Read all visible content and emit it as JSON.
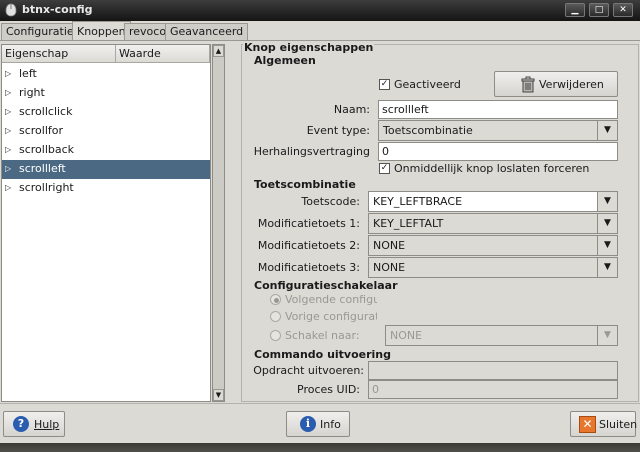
{
  "window": {
    "title": "btnx-config"
  },
  "tabs": [
    {
      "label": "Configuraties"
    },
    {
      "label": "Knoppen"
    },
    {
      "label": "revoco"
    },
    {
      "label": "Geavanceerd"
    }
  ],
  "tree": {
    "columns": [
      "Eigenschap",
      "Waarde"
    ],
    "items": [
      {
        "label": "left"
      },
      {
        "label": "right"
      },
      {
        "label": "scrollclick"
      },
      {
        "label": "scrollfor"
      },
      {
        "label": "scrollback"
      },
      {
        "label": "scrollleft",
        "selected": true
      },
      {
        "label": "scrollright"
      }
    ]
  },
  "props": {
    "frame_title": "Knop eigenschappen",
    "algemeen": {
      "title": "Algemeen",
      "enabled_label": "Geactiveerd",
      "enabled_checked": true,
      "delete_button": "Verwijderen",
      "name_label": "Naam:",
      "name_value": "scrollleft",
      "event_type_label": "Event type:",
      "event_type_value": "Toetscombinatie",
      "delay_label": "Herhalingsvertraging",
      "delay_value": "0",
      "force_release_label": "Onmiddellijk knop loslaten forceren",
      "force_release_checked": true
    },
    "keycombo": {
      "title": "Toetscombinatie",
      "keycode_label": "Toetscode:",
      "keycode_value": "KEY_LEFTBRACE",
      "mod1_label": "Modificatietoets 1:",
      "mod1_value": "KEY_LEFTALT",
      "mod2_label": "Modificatietoets 2:",
      "mod2_value": "NONE",
      "mod3_label": "Modificatietoets 3:",
      "mod3_value": "NONE"
    },
    "configswitch": {
      "title": "Configuratieschakelaar",
      "next_label": "Volgende configura",
      "prev_label": "Vorige configuratie",
      "switch_label": "Schakel naar:",
      "switch_value": "NONE"
    },
    "command": {
      "title": "Commando uitvoering",
      "exec_label": "Opdracht uitvoeren:",
      "exec_value": "",
      "uid_label": "Proces UID:",
      "uid_value": "0"
    }
  },
  "buttons": {
    "help": "Hulp",
    "info": "Info",
    "close": "Sluiten"
  },
  "colors": {
    "selection": "#4b6983",
    "titlebar": "#1e1e1e",
    "close_icon": "#e8772e",
    "help_icon": "#2a5db0"
  }
}
